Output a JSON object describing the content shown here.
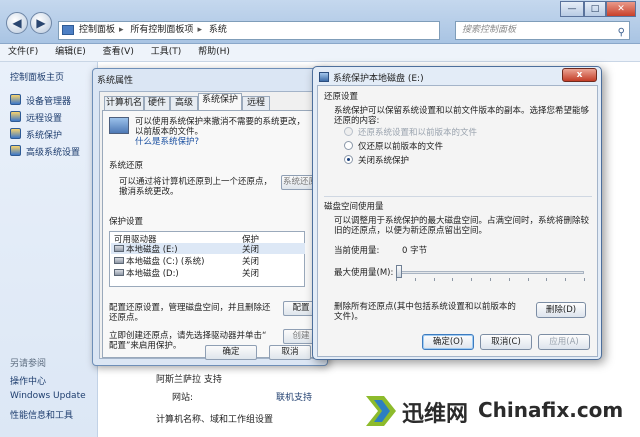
{
  "explorer": {
    "address": [
      "控制面板",
      "所有控制面板项",
      "系统"
    ],
    "search_placeholder": "搜索控制面板",
    "menu": [
      "文件(F)",
      "编辑(E)",
      "查看(V)",
      "工具(T)",
      "帮助(H)"
    ],
    "nav": {
      "home": "控制面板主页",
      "links": [
        "设备管理器",
        "远程设置",
        "系统保护",
        "高级系统设置"
      ],
      "see_also": "另请参阅",
      "see_also_links": [
        "操作中心",
        "Windows Update",
        "性能信息和工具"
      ]
    },
    "background": {
      "support_heading": "阿斯兰萨拉 支持",
      "website_label": "网站:",
      "website_link": "联机支持",
      "domain_heading": "计算机名称、域和工作组设置"
    }
  },
  "sysprops": {
    "title": "系统属性",
    "tabs": [
      "计算机名",
      "硬件",
      "高级",
      "系统保护",
      "远程"
    ],
    "active_tab": "系统保护",
    "intro": [
      "可以使用系统保护来撤消不需要的系统更改，",
      "以前版本的文件。"
    ],
    "intro_link": "什么是系统保护?",
    "restore_heading": "系统还原",
    "restore_text": [
      "可以通过将计算机还原到上一个还原点，",
      "撤消系统更改。"
    ],
    "restore_button": "系统还原(S)...",
    "protection_heading": "保护设置",
    "table_headers": [
      "可用驱动器",
      "保护"
    ],
    "drives": [
      {
        "name": "本地磁盘 (E:)",
        "protection": "关闭"
      },
      {
        "name": "本地磁盘 (C:) (系统)",
        "protection": "关闭"
      },
      {
        "name": "本地磁盘 (D:)",
        "protection": "关闭"
      }
    ],
    "configure_text": [
      "配置还原设置，管理磁盘空间，并且删除还",
      "还原点。"
    ],
    "configure_button": "配置(O)...",
    "create_text": [
      "立即创建还原点，请先选择驱动器并单击“",
      "配置”来启用保护。"
    ],
    "create_button": "创建(C)...",
    "ok": "确定",
    "cancel": "取消"
  },
  "diskdlg": {
    "title": "系统保护本地磁盘 (E:)",
    "close": "x",
    "restore_heading": "还原设置",
    "restore_text": [
      "系统保护可以保留系统设置和以前文件版本的副本。选择您希望能够",
      "还原的内容:"
    ],
    "options": [
      {
        "label": "还原系统设置和以前版本的文件",
        "state": "disabled"
      },
      {
        "label": "仅还原以前版本的文件",
        "state": "unchecked"
      },
      {
        "label": "关闭系统保护",
        "state": "checked"
      }
    ],
    "usage_heading": "磁盘空间使用量",
    "usage_text": [
      "可以调整用于系统保护的最大磁盘空间。占满空间时，系统将删除较",
      "旧的还原点，以便为新还原点留出空间。"
    ],
    "current_usage_label": "当前使用量:",
    "current_usage_value": "0 字节",
    "max_usage_label": "最大使用量(M):",
    "max_usage_fraction": 0.0,
    "delete_text": [
      "删除所有还原点(其中包括系统设置和以前版本的",
      "文件)。"
    ],
    "delete_button": "删除(D)",
    "ok": "确定(O)",
    "cancel": "取消(C)",
    "apply": "应用(A)"
  },
  "watermark": {
    "brand_cn": "迅维网",
    "brand_en": "Chinafix.com"
  },
  "colors": {
    "link": "#1e3d6e",
    "accent": "#3d7bbf"
  }
}
